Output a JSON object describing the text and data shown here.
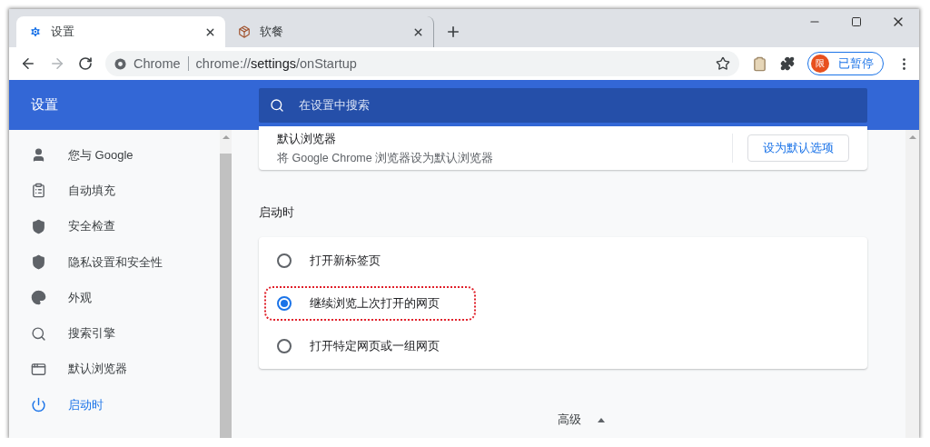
{
  "tabs": [
    {
      "label": "设置",
      "selected": true
    },
    {
      "label": "软餐",
      "selected": false
    }
  ],
  "address_bar": {
    "site_label": "Chrome",
    "url_prefix": "chrome://",
    "url_host": "settings",
    "url_path": "/onStartup"
  },
  "profile": {
    "avatar_letter": "限",
    "status": "已暂停"
  },
  "header": {
    "title": "设置",
    "search_placeholder": "在设置中搜索"
  },
  "sidebar": {
    "items": [
      {
        "label": "您与 Google",
        "selected": false
      },
      {
        "label": "自动填充",
        "selected": false
      },
      {
        "label": "安全检查",
        "selected": false
      },
      {
        "label": "隐私设置和安全性",
        "selected": false
      },
      {
        "label": "外观",
        "selected": false
      },
      {
        "label": "搜索引擎",
        "selected": false
      },
      {
        "label": "默认浏览器",
        "selected": false
      },
      {
        "label": "启动时",
        "selected": true
      }
    ]
  },
  "default_browser": {
    "title": "默认浏览器",
    "description": "将 Google Chrome 浏览器设为默认浏览器",
    "button": "设为默认选项"
  },
  "startup": {
    "heading": "启动时",
    "options": [
      {
        "label": "打开新标签页",
        "selected": false,
        "highlighted": false
      },
      {
        "label": "继续浏览上次打开的网页",
        "selected": true,
        "highlighted": true
      },
      {
        "label": "打开特定网页或一组网页",
        "selected": false,
        "highlighted": false
      }
    ]
  },
  "advanced": {
    "label": "高级",
    "expanded": true
  }
}
